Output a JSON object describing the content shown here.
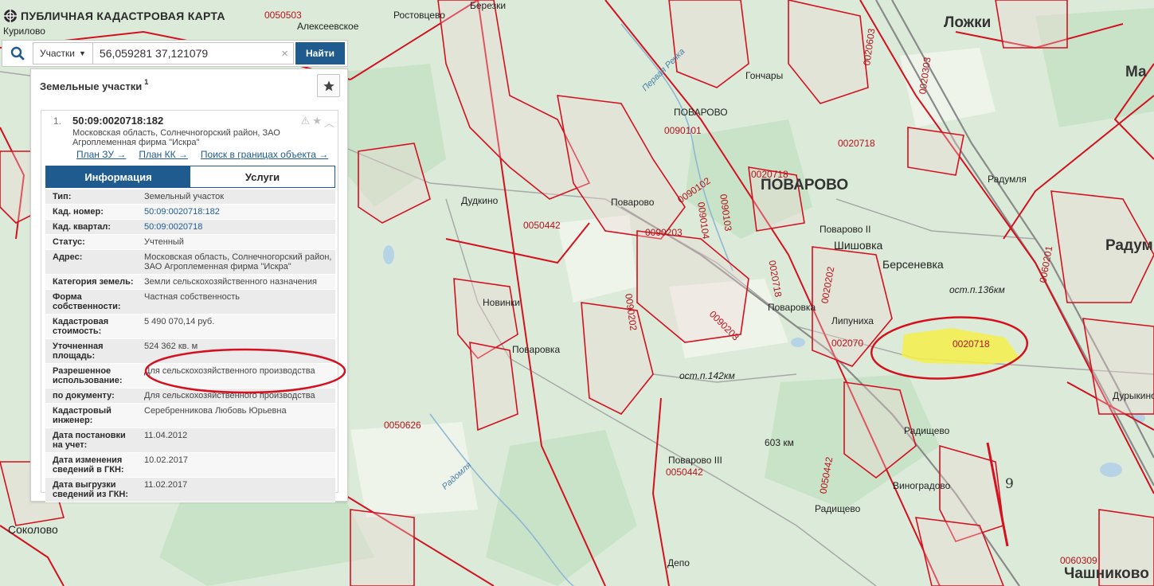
{
  "app": {
    "title": "ПУБЛИЧНАЯ КАДАСТРОВАЯ КАРТА"
  },
  "search": {
    "type_label": "Участки",
    "query": "56,059281 37,121079",
    "find_label": "Найти"
  },
  "panel": {
    "title": "Земельные участки",
    "count": "1",
    "item": {
      "number": "1.",
      "cad_number": "50:09:0020718:182",
      "address": "Московская область, Солнечногорский район, ЗАО Агроплеменная фирма \"Искра\"",
      "links": [
        "План ЗУ →",
        "План КК →",
        "Поиск в границах объекта →"
      ],
      "tabs": [
        "Информация",
        "Услуги"
      ],
      "rows": [
        {
          "k": "Тип:",
          "v": "Земельный участок"
        },
        {
          "k": "Кад. номер:",
          "v": "50:09:0020718:182"
        },
        {
          "k": "Кад. квартал:",
          "v": "50:09:0020718"
        },
        {
          "k": "Статус:",
          "v": "Учтенный"
        },
        {
          "k": "Адрес:",
          "v": "Московская область, Солнечногорский район, ЗАО Агроплеменная фирма \"Искра\""
        },
        {
          "k": "Категория земель:",
          "v": "Земли сельскохозяйственного назначения"
        },
        {
          "k": "Форма собственности:",
          "v": "Частная собственность"
        },
        {
          "k": "Кадастровая стоимость:",
          "v": "5 490 070,14 руб."
        },
        {
          "k": "Уточненная площадь:",
          "v": "524 362 кв. м"
        },
        {
          "k": "Разрешенное использование:",
          "v": "Для сельскохозяйственного производства"
        },
        {
          "k": "по документу:",
          "v": "Для сельскохозяйственного производства"
        },
        {
          "k": "Кадастровый инженер:",
          "v": "Серебренникова Любовь Юрьевна"
        },
        {
          "k": "Дата постановки на учет:",
          "v": "11.04.2012"
        },
        {
          "k": "Дата изменения сведений в ГКН:",
          "v": "10.02.2017"
        },
        {
          "k": "Дата выгрузки сведений из ГКН:",
          "v": "11.02.2017"
        }
      ]
    }
  },
  "map": {
    "places": {
      "kurilovo": "Курилово",
      "alekseevskoe": "Алексеевское",
      "rostovcevo": "Ростовцево",
      "berezki": "Березки",
      "lozhki": "Ложки",
      "ma": "Ма",
      "gonchary": "Гончары",
      "povarovo_up": "ПОВАРОВО",
      "povarovo_big": "ПОВАРОВО",
      "dudkino": "Дудкино",
      "povarovo_small": "Поварово",
      "radumlya": "Радумля",
      "radum": "Радум",
      "povarovo2": "Поварово II",
      "shishovka": "Шишовка",
      "berseneva": "Берсеневка",
      "novinki": "Новинки",
      "povarovka_w": "Поваровка",
      "povarovka_c": "Поваровка",
      "lipuniha": "Липуниха",
      "durykino": "Дурыкино",
      "radishevo": "Радищево",
      "vinogradovo": "Виноградово",
      "povarovo3": "Поварово III",
      "radishevo2": "Радищево",
      "depo": "Депо",
      "sokolovo": "Соколово",
      "chashnikovo": "Чашниково"
    },
    "stations": {
      "st136": "ост.п.136км",
      "st142": "ост.п.142км",
      "km603": "603 км"
    },
    "water": {
      "pervaya": "Первая Речка",
      "radomlya": "Радомля"
    },
    "quarters": {
      "q0050503": "0050503",
      "q0020603": "0020603",
      "q0020303": "0020303",
      "q0020718a": "0020718",
      "q0020718b": "0020718",
      "q0090101": "0090101",
      "q0090102": "0090102",
      "q0090104": "0090104",
      "q0090103": "0090103",
      "q0090203a": "0090203",
      "q0090202": "0090202",
      "q0090203b": "0090203",
      "q0050442a": "0050442",
      "q0050442b": "0050442",
      "q0050442c": "0050442",
      "q0020718c": "0020718",
      "q0020202": "0020202",
      "q002070": "002070",
      "q0020718hl": "0020718",
      "q0060201": "0060201",
      "q0050626": "0050626",
      "q0060309": "0060309"
    },
    "hand_digit": "9"
  }
}
